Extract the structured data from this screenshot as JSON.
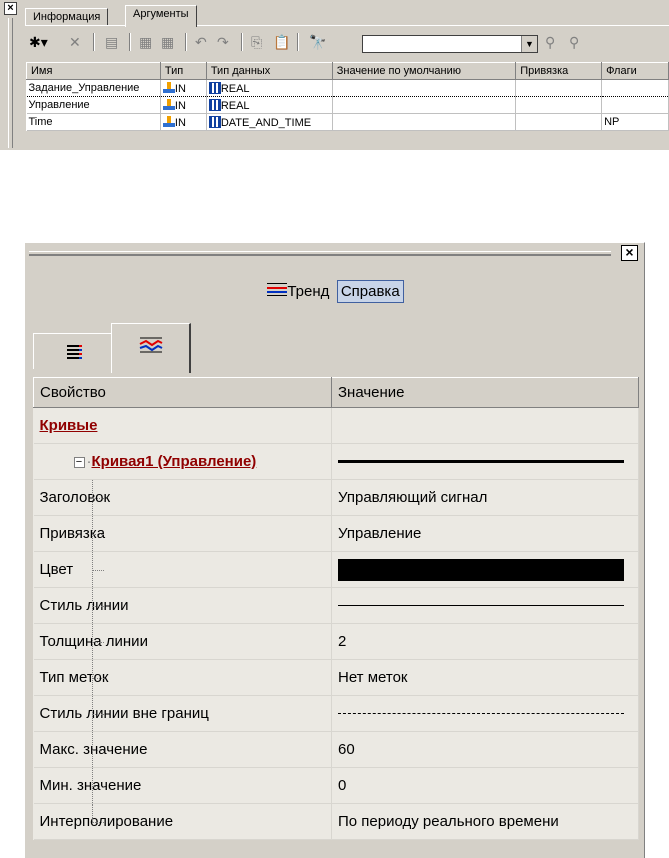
{
  "top": {
    "tabs": [
      "Информация",
      "Аргументы"
    ],
    "active_tab": 1,
    "search_value": "",
    "columns": [
      "Имя",
      "Тип",
      "Тип данных",
      "Значение по умолчанию",
      "Привязка",
      "Флаги"
    ],
    "rows": [
      {
        "name": "Задание_Управление",
        "dir": "IN",
        "type": "REAL",
        "default": "",
        "binding": "",
        "flags": ""
      },
      {
        "name": "Управление",
        "dir": "IN",
        "type": "REAL",
        "default": "",
        "binding": "",
        "flags": ""
      },
      {
        "name": "Time",
        "dir": "IN",
        "type": "DATE_AND_TIME",
        "default": "",
        "binding": "",
        "flags": "NP"
      }
    ]
  },
  "panel": {
    "close_symbol": "×",
    "title": "Тренд",
    "help": "Справка",
    "grid_headers": [
      "Свойство",
      "Значение"
    ],
    "category": "Кривые",
    "curve_name": "Кривая1 (Управление)",
    "expander": "−",
    "properties": [
      {
        "name": "Заголовок",
        "value": "Управляющий сигнал",
        "kind": "text"
      },
      {
        "name": "Привязка",
        "value": "Управление",
        "kind": "text"
      },
      {
        "name": "Цвет",
        "value": "",
        "kind": "color"
      },
      {
        "name": "Стиль линии",
        "value": "",
        "kind": "line-thin"
      },
      {
        "name": "Толщина линии",
        "value": "2",
        "kind": "text"
      },
      {
        "name": "Тип меток",
        "value": "Нет меток",
        "kind": "text"
      },
      {
        "name": "Стиль линии вне границ",
        "value": "",
        "kind": "line-dash"
      },
      {
        "name": "Макс. значение",
        "value": "60",
        "kind": "text"
      },
      {
        "name": "Мин. значение",
        "value": "0",
        "kind": "text"
      },
      {
        "name": "Интерполирование",
        "value": "По периоду реального времени",
        "kind": "text"
      }
    ],
    "curve_color": "#000000"
  }
}
